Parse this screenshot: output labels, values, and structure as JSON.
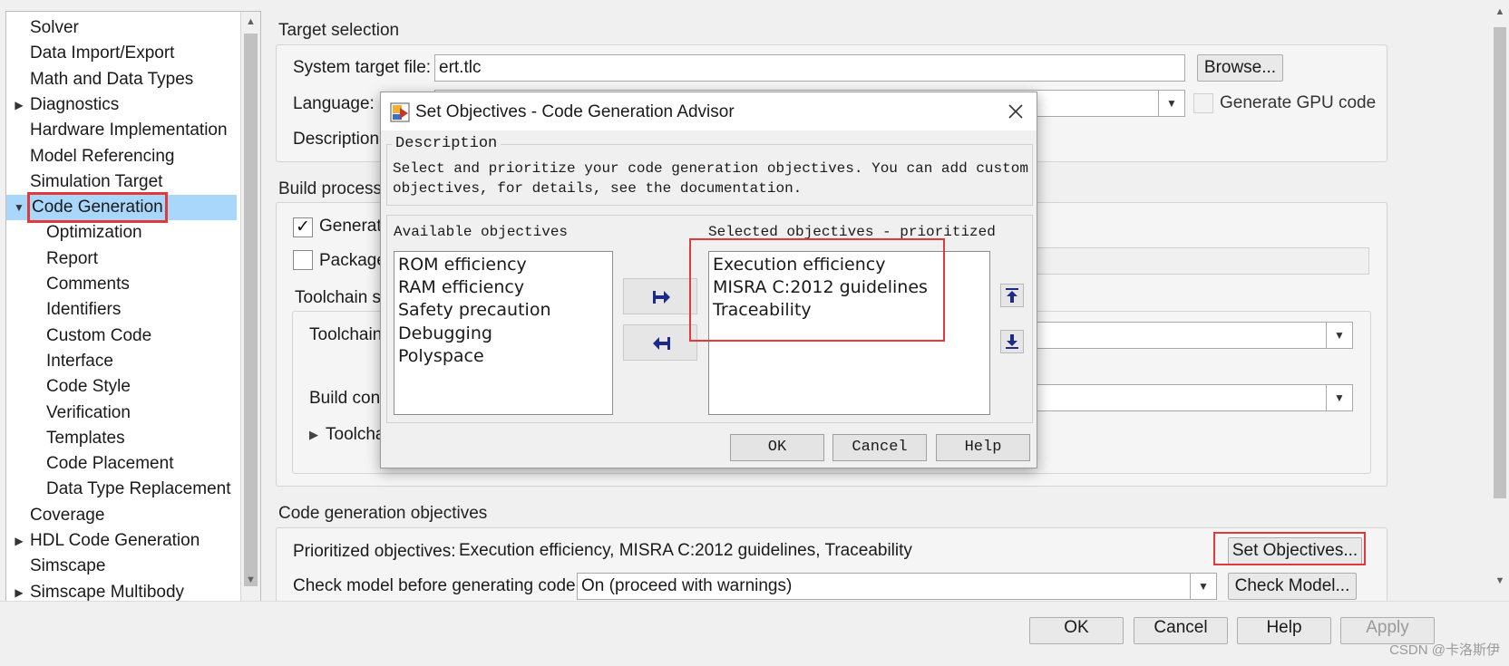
{
  "tree": {
    "items": [
      {
        "label": "Solver",
        "arrow": ""
      },
      {
        "label": "Data Import/Export",
        "arrow": ""
      },
      {
        "label": "Math and Data Types",
        "arrow": ""
      },
      {
        "label": "Diagnostics",
        "arrow": "▶"
      },
      {
        "label": "Hardware Implementation",
        "arrow": ""
      },
      {
        "label": "Model Referencing",
        "arrow": ""
      },
      {
        "label": "Simulation Target",
        "arrow": ""
      },
      {
        "label": "Code Generation",
        "arrow": "▼",
        "selected": true
      },
      {
        "label": "Optimization",
        "arrow": ""
      },
      {
        "label": "Report",
        "arrow": ""
      },
      {
        "label": "Comments",
        "arrow": ""
      },
      {
        "label": "Identifiers",
        "arrow": ""
      },
      {
        "label": "Custom Code",
        "arrow": ""
      },
      {
        "label": "Interface",
        "arrow": ""
      },
      {
        "label": "Code Style",
        "arrow": ""
      },
      {
        "label": "Verification",
        "arrow": ""
      },
      {
        "label": "Templates",
        "arrow": ""
      },
      {
        "label": "Code Placement",
        "arrow": ""
      },
      {
        "label": "Data Type Replacement",
        "arrow": ""
      },
      {
        "label": "Coverage",
        "arrow": ""
      },
      {
        "label": "HDL Code Generation",
        "arrow": "▶"
      },
      {
        "label": "Simscape",
        "arrow": ""
      },
      {
        "label": "Simscape Multibody",
        "arrow": "▶"
      }
    ]
  },
  "target_selection": {
    "title": "Target selection",
    "system_target_label": "System target file:",
    "system_target_value": "ert.tlc",
    "browse_label": "Browse...",
    "language_label": "Language:",
    "generate_gpu_label": "Generate GPU code",
    "description_label": "Description:"
  },
  "build_process": {
    "title": "Build process",
    "generate_label": "Generat",
    "package_label": "Package",
    "toolchain_settings_label": "Toolchain se",
    "toolchain_label": "Toolchain",
    "build_config_label": "Build conf",
    "toolchain_details_label": "Toolcha"
  },
  "objectives": {
    "title": "Code generation objectives",
    "prioritized_label": "Prioritized objectives:",
    "prioritized_value": "Execution efficiency, MISRA C:2012 guidelines, Traceability",
    "set_objectives_label": "Set Objectives...",
    "check_model_label": "Check model before generating code:",
    "check_model_value": "On (proceed with warnings)",
    "check_model_button": "Check Model..."
  },
  "dialog": {
    "title": "Set Objectives - Code Generation Advisor",
    "description_legend": "Description",
    "description_text_1": "Select and prioritize your code generation objectives. You can add custom",
    "description_text_2": "objectives, for details, see the documentation.",
    "available_label": "Available objectives",
    "selected_label": "Selected objectives - prioritized",
    "available": [
      "ROM efficiency",
      "RAM efficiency",
      "Safety precaution",
      "Debugging",
      "Polyspace"
    ],
    "selected": [
      "Execution efficiency",
      "MISRA C:2012 guidelines",
      "Traceability"
    ],
    "ok_label": "OK",
    "cancel_label": "Cancel",
    "help_label": "Help"
  },
  "bottom": {
    "ok_label": "OK",
    "cancel_label": "Cancel",
    "help_label": "Help",
    "apply_label": "Apply"
  },
  "watermark": "CSDN @卡洛斯伊",
  "colors": {
    "highlight_red": "#e03a3a",
    "selection_blue": "#a9d7fb",
    "arrow_blue": "#1e2a8a"
  }
}
